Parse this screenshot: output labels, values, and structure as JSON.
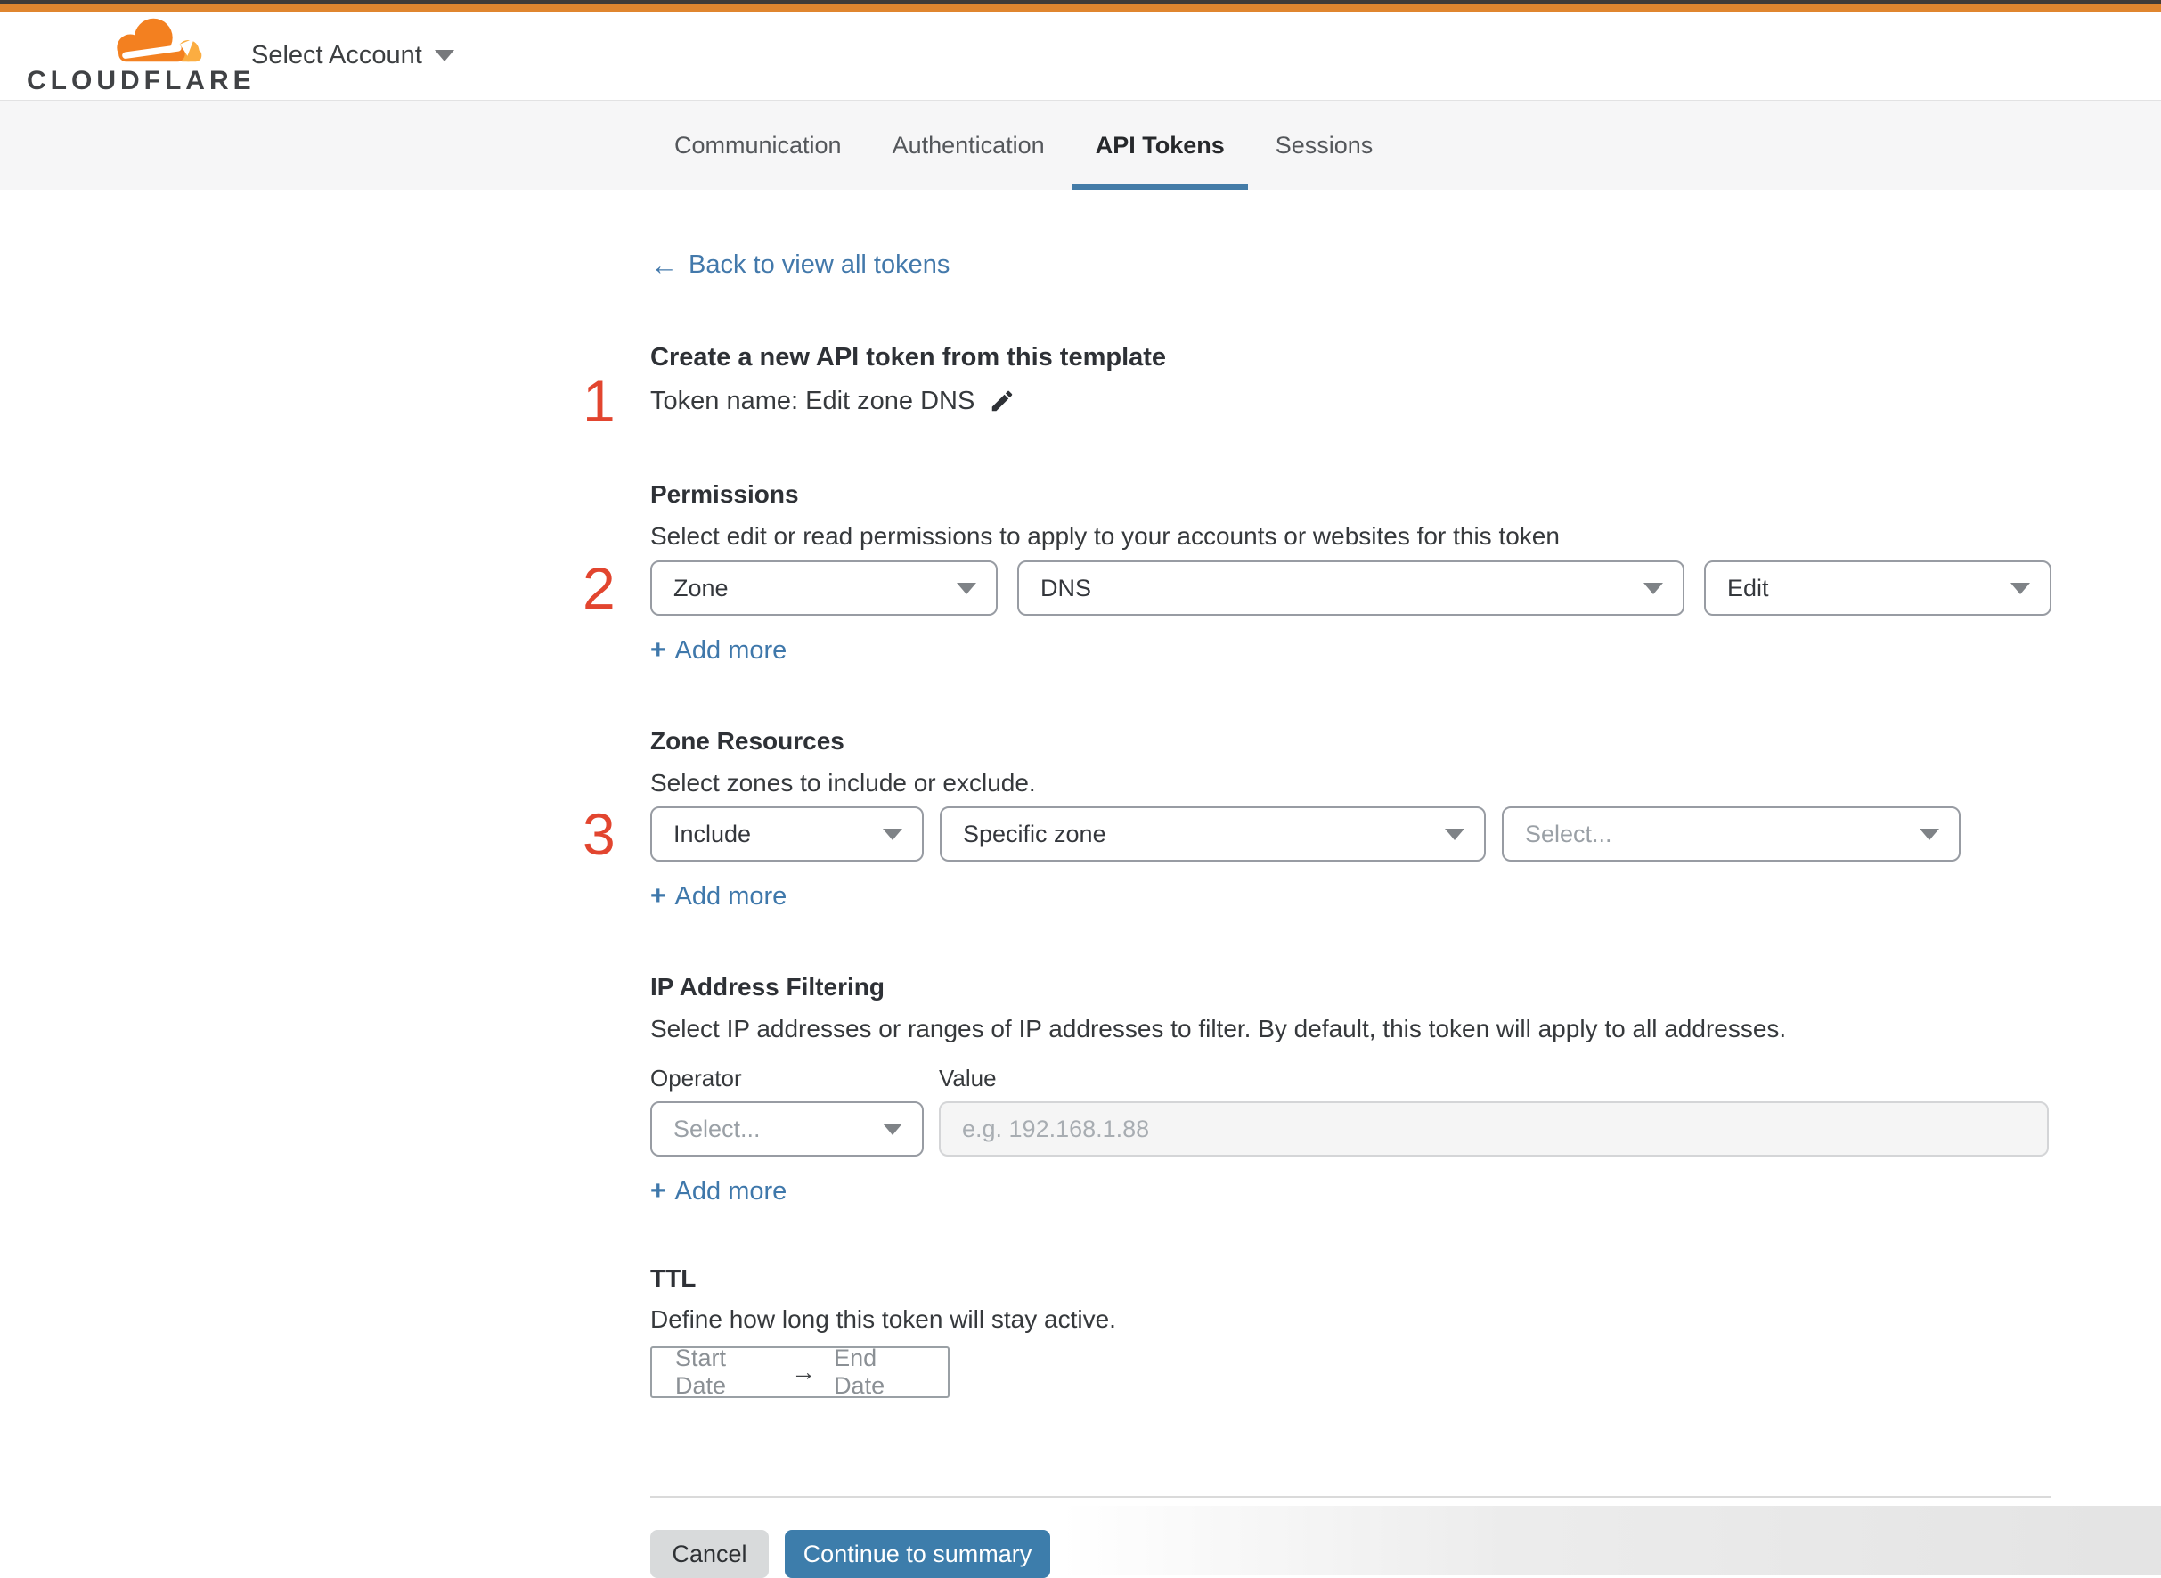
{
  "header": {
    "logo_text": "CLOUDFLARE",
    "account_selector_label": "Select Account"
  },
  "tabs": {
    "communication": "Communication",
    "authentication": "Authentication",
    "api_tokens": "API Tokens",
    "sessions": "Sessions"
  },
  "back_link": {
    "arrow": "←",
    "label": "Back to view all tokens"
  },
  "template_section": {
    "step_number": "1",
    "title": "Create a new API token from this template",
    "token_name_line": "Token name: Edit zone DNS"
  },
  "permissions": {
    "step_number": "2",
    "title": "Permissions",
    "description": "Select edit or read permissions to apply to your accounts or websites for this token",
    "scope_value": "Zone",
    "resource_value": "DNS",
    "access_value": "Edit",
    "add_more": {
      "plus": "+",
      "label": "Add more"
    }
  },
  "zone_resources": {
    "step_number": "3",
    "title": "Zone Resources",
    "description": "Select zones to include or exclude.",
    "mode_value": "Include",
    "type_value": "Specific zone",
    "zone_placeholder": "Select...",
    "add_more": {
      "plus": "+",
      "label": "Add more"
    }
  },
  "ip_filtering": {
    "title": "IP Address Filtering",
    "description": "Select IP addresses or ranges of IP addresses to filter. By default, this token will apply to all addresses.",
    "operator_label": "Operator",
    "value_label": "Value",
    "operator_placeholder": "Select...",
    "value_placeholder": "e.g. 192.168.1.88",
    "add_more": {
      "plus": "+",
      "label": "Add more"
    }
  },
  "ttl": {
    "title": "TTL",
    "description": "Define how long this token will stay active.",
    "start_date_placeholder": "Start Date",
    "arrow": "→",
    "end_date_placeholder": "End Date"
  },
  "footer": {
    "cancel_label": "Cancel",
    "continue_label": "Continue to summary"
  },
  "colors": {
    "top_bar_orange": "#e0862f",
    "brand_orange": "#f38020",
    "brand_orange_light": "#fbad41",
    "link_blue": "#4078ab",
    "active_tab_underline": "#447ca8",
    "primary_button_blue": "#3d7dab",
    "step_number_red": "#e2452f",
    "tab_band_bg": "#f6f6f7"
  }
}
